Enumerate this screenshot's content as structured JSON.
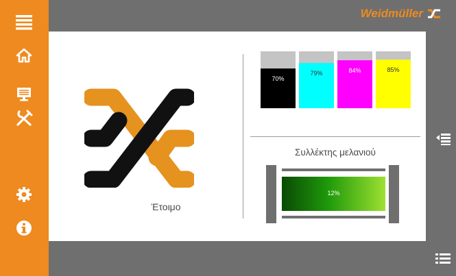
{
  "brand": {
    "name": "Weidmüller"
  },
  "sidebar": {
    "items": [
      {
        "name": "menu",
        "icon": "hamburger-icon"
      },
      {
        "name": "home",
        "icon": "home-icon"
      },
      {
        "name": "display",
        "icon": "monitor-icon"
      },
      {
        "name": "tools",
        "icon": "tools-icon"
      },
      {
        "name": "settings",
        "icon": "gear-icon"
      },
      {
        "name": "info",
        "icon": "info-icon"
      }
    ]
  },
  "status": {
    "label": "Έτοιμο"
  },
  "ink_levels": [
    {
      "color": "black",
      "hex": "#000000",
      "level": 70,
      "label": "70%",
      "text_color": "#ffffff"
    },
    {
      "color": "cyan",
      "hex": "#00ffff",
      "level": 79,
      "label": "79%",
      "text_color": "#333333"
    },
    {
      "color": "magenta",
      "hex": "#ff00ff",
      "level": 84,
      "label": "84%",
      "text_color": "#ffffff"
    },
    {
      "color": "yellow",
      "hex": "#ffff00",
      "level": 85,
      "label": "85%",
      "text_color": "#333333"
    }
  ],
  "collector": {
    "title": "Συλλέκτης μελανιού",
    "level": 12,
    "label": "12%"
  },
  "colors": {
    "accent": "#ee8a1f",
    "frame": "#6f6f6f",
    "logo_dark": "#111111"
  }
}
